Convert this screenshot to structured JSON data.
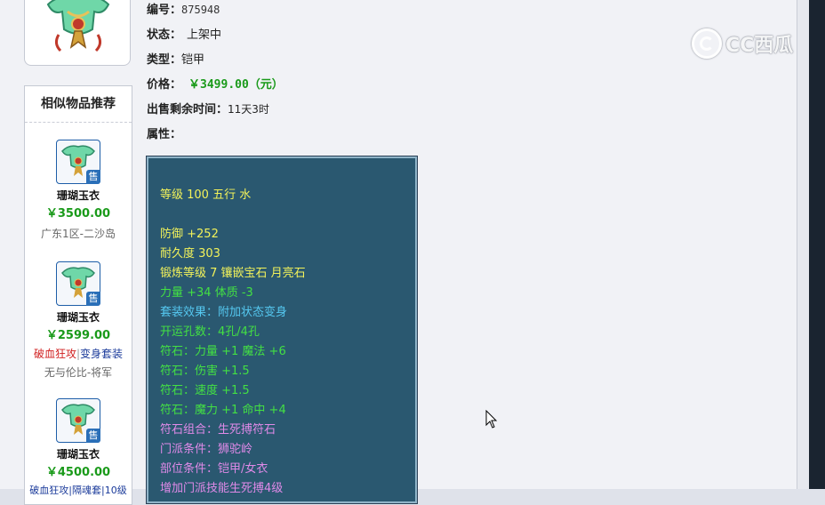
{
  "watermark": {
    "text": "CC西瓜"
  },
  "item": {
    "id_label": "编号：",
    "id_value": "875948",
    "status_label": "状态：",
    "status_value": "上架中",
    "type_label": "类型：",
    "type_value": "铠甲",
    "price_label": "价格：",
    "price_value": "￥3499.00（元）",
    "remaining_label": "出售剩余时间：",
    "remaining_value": "11天3时",
    "attributes_label": "属性："
  },
  "attributes": [
    {
      "text": "等级 100 五行 水",
      "color": "yellow"
    },
    {
      "text": "防御 +252",
      "color": "yellow"
    },
    {
      "text": "耐久度 303",
      "color": "yellow"
    },
    {
      "text": "锻炼等级 7 镶嵌宝石 月亮石",
      "color": "yellow"
    },
    {
      "text": "力量 +34 体质 -3",
      "color": "green"
    },
    {
      "text": "套装效果：附加状态变身",
      "color": "cyan"
    },
    {
      "text": "开运孔数：4孔/4孔",
      "color": "green"
    },
    {
      "text": "符石：力量 +1 魔法 +6",
      "color": "green"
    },
    {
      "text": "符石：伤害 +1.5",
      "color": "green"
    },
    {
      "text": "符石：速度 +1.5",
      "color": "green"
    },
    {
      "text": "符石：魔力 +1 命中 +4",
      "color": "green"
    },
    {
      "text": "符石组合：生死搏符石",
      "color": "pink"
    },
    {
      "text": "门派条件：狮驼岭",
      "color": "pink"
    },
    {
      "text": "部位条件：铠甲/女衣",
      "color": "pink"
    },
    {
      "text": "增加门派技能生死搏4级",
      "color": "pink"
    }
  ],
  "similar": {
    "title": "相似物品推荐",
    "badge": "售",
    "items": [
      {
        "name": "珊瑚玉衣",
        "price": "￥3500.00",
        "server": "广东1区-二沙岛"
      },
      {
        "name": "珊瑚玉衣",
        "price": "￥2599.00",
        "tag1": "破血狂攻",
        "sep": "|",
        "tag2": "变身套装",
        "server": "无与伦比-将军"
      },
      {
        "name": "珊瑚玉衣",
        "price": "￥4500.00",
        "tags_line": "破血狂攻|隔魂套|10级"
      }
    ]
  },
  "colors": {
    "panel_bg": "#2a5870",
    "price_green": "#1a9a1a",
    "attr_yellow": "#f2f25a",
    "attr_green": "#43e043",
    "attr_cyan": "#55c8f0",
    "attr_pink": "#e08ae8"
  }
}
